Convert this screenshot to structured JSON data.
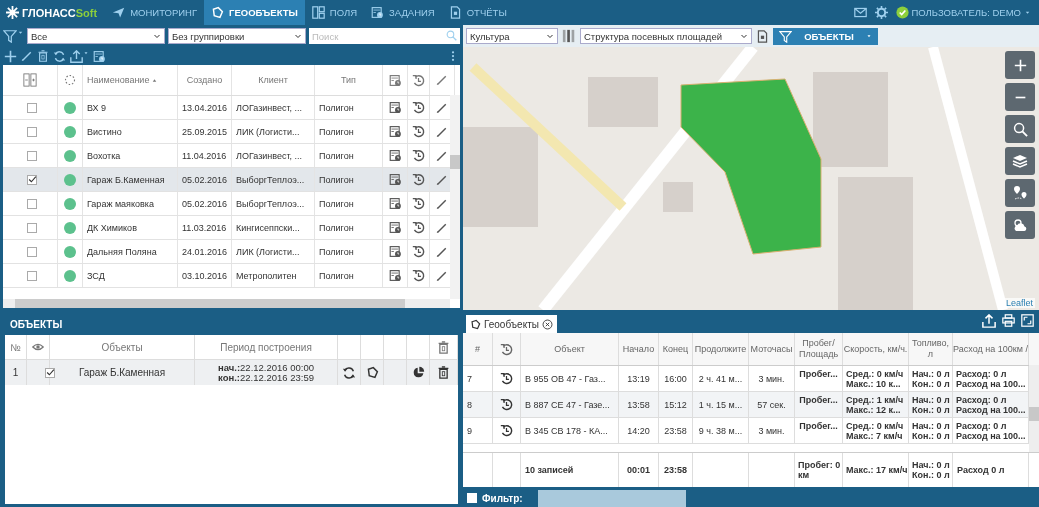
{
  "header": {
    "logo_main": "ГЛОНАСС",
    "logo_accent": "Soft",
    "nav": [
      {
        "kind": "monitoring",
        "label": "МОНИТОРИНГ",
        "selected": false
      },
      {
        "kind": "geo",
        "label": "ГЕООБЪЕКТЫ",
        "selected": true
      },
      {
        "kind": "fields",
        "label": "ПОЛЯ",
        "selected": false
      },
      {
        "kind": "tasks",
        "label": "ЗАДАНИЯ",
        "selected": false
      },
      {
        "kind": "reports",
        "label": "ОТЧЁТЫ",
        "selected": false
      }
    ],
    "user": "ПОЛЬЗОВАТЕЛЬ: DEMO"
  },
  "left_toolbar": {
    "filter": "Все",
    "grouping": "Без группировки",
    "search": {
      "placeholder": "Поиск"
    }
  },
  "geo_table": {
    "columns": [
      "Наименование",
      "Создано",
      "Клиент",
      "Тип"
    ],
    "rows": [
      {
        "name": "ВХ 9",
        "created": "13.04.2016",
        "client": "ЛОГазинвест, ...",
        "type": "Полигон",
        "checked": false
      },
      {
        "name": "Вистино",
        "created": "25.09.2015",
        "client": "ЛИК (Логисти...",
        "type": "Полигон",
        "checked": false
      },
      {
        "name": "Вохотка",
        "created": "11.04.2016",
        "client": "ЛОГазинвест, ...",
        "type": "Полигон",
        "checked": false
      },
      {
        "name": "Гараж Б.Каменная",
        "created": "05.02.2016",
        "client": "ВыборгТеплоэ...",
        "type": "Полигон",
        "checked": true
      },
      {
        "name": "Гараж маяковка",
        "created": "05.02.2016",
        "client": "ВыборгТеплоэ...",
        "type": "Полигон",
        "checked": false
      },
      {
        "name": "ДК Химиков",
        "created": "11.03.2016",
        "client": "Кингисеппски...",
        "type": "Полигон",
        "checked": false
      },
      {
        "name": "Дальняя Поляна",
        "created": "24.01.2016",
        "client": "ЛИК (Логисти...",
        "type": "Полигон",
        "checked": false
      },
      {
        "name": "ЗСД",
        "created": "03.10.2016",
        "client": "Метрополитен",
        "type": "Полигон",
        "checked": false
      }
    ]
  },
  "objects_panel": {
    "title": "ОБЪЕКТЫ",
    "columns": [
      "№",
      "Объекты",
      "Период построения"
    ],
    "rows": [
      {
        "number": "1",
        "visible": true,
        "name": "Гараж Б.Каменная",
        "start_label": "нач.:",
        "start": "22.12.2016 00:00",
        "end_label": "кон.:",
        "end": "22.12.2016 23:59"
      }
    ]
  },
  "map_toolbar": {
    "crop": "Культура",
    "structure": "Структура посевных площадей",
    "objects_button": "ОБЪЕКТЫ"
  },
  "map": {
    "attribution": "Leaflet"
  },
  "report": {
    "tab": "Геообъекты",
    "columns": [
      "#",
      "Объект",
      "Начало",
      "Конец",
      "Продолжите",
      "Моточасы",
      "Пробег/ Площадь",
      "Скорость, км/ч.",
      "Топливо, л",
      "Расход на 100км /"
    ],
    "rows": [
      {
        "number": "7",
        "object": "В 955 ОВ 47 - Газ...",
        "start": "13:19",
        "end": "16:00",
        "duration": "2 ч. 41 м...",
        "engine_hours": "3 мин.",
        "mileage": "Пробег...",
        "speed_avg": "Сред.: 0 км/ч",
        "speed_max": "Макс.: 10 к...",
        "fuel_start": "Нач.: 0 л",
        "fuel_end": "Кон.: 0 л",
        "consumption": "Расход: 0 л",
        "consumption_100": "Расход на 100..."
      },
      {
        "number": "8",
        "object": "В 887 СЕ 47 - Газе...",
        "start": "13:58",
        "end": "15:12",
        "duration": "1 ч. 15 м...",
        "engine_hours": "57 сек.",
        "mileage": "Пробег...",
        "speed_avg": "Сред.: 1 км/ч",
        "speed_max": "Макс.: 12 к...",
        "fuel_start": "Нач.: 0 л",
        "fuel_end": "Кон.: 0 л",
        "consumption": "Расход: 0 л",
        "consumption_100": "Расход на 100..."
      },
      {
        "number": "9",
        "object": "В 345 СВ 178 - КА...",
        "start": "14:20",
        "end": "23:58",
        "duration": "9 ч. 38 м...",
        "engine_hours": "3 мин.",
        "mileage": "Пробег...",
        "speed_avg": "Сред.: 0 км/ч",
        "speed_max": "Макс.: 7 км/ч",
        "fuel_start": "Нач.: 0 л",
        "fuel_end": "Кон.: 0 л",
        "consumption": "Расход: 0 л",
        "consumption_100": "Расход на 100..."
      }
    ],
    "footer": {
      "count": "10 записей",
      "start": "00:01",
      "end": "23:58",
      "mileage": "Пробег: 0 км",
      "speed_max": "Макс.: 17 км/ч",
      "fuel_start": "Нач.: 0 л",
      "fuel_end": "Кон.: 0 л",
      "consumption": "Расход 0 л"
    },
    "filter": {
      "label": "Фильтр:",
      "checked": false
    }
  }
}
